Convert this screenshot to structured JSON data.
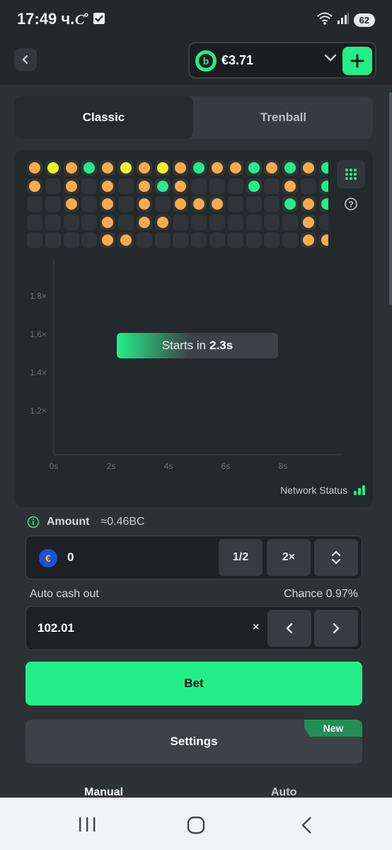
{
  "status_bar": {
    "time": "17:49 ч.",
    "battery": "62",
    "wifi_label": "6"
  },
  "header": {
    "balance": "€3.71",
    "coin_letter": "b"
  },
  "mode_tabs": [
    {
      "label": "Classic",
      "active": true
    },
    {
      "label": "Trenball",
      "active": false
    }
  ],
  "history_colors": {
    "orange": "#fcaa4a",
    "yellow": "#f1f12c",
    "green": "#24ee89"
  },
  "history_rows": [
    [
      "orange",
      "yellow",
      "orange",
      "green",
      "orange",
      "yellow",
      "orange",
      "yellow",
      "orange",
      "green",
      "orange",
      "orange",
      "green",
      "orange",
      "green",
      "orange",
      "green"
    ],
    [
      "orange",
      "",
      "orange",
      "",
      "orange",
      "",
      "orange",
      "green",
      "orange",
      "",
      "",
      "",
      "green",
      "",
      "orange",
      "",
      "green"
    ],
    [
      "",
      "",
      "orange",
      "",
      "orange",
      "",
      "orange",
      "",
      "orange",
      "orange",
      "orange",
      "",
      "",
      "",
      "green",
      "orange",
      "green"
    ],
    [
      "",
      "",
      "",
      "",
      "orange",
      "",
      "orange",
      "orange",
      "",
      "",
      "",
      "",
      "",
      "",
      "",
      "orange",
      ""
    ],
    [
      "",
      "",
      "",
      "",
      "orange",
      "orange",
      "",
      "",
      "",
      "",
      "",
      "",
      "",
      "",
      "",
      "orange",
      "orange"
    ]
  ],
  "chart_data": {
    "type": "line",
    "y_ticks": [
      "1.8×",
      "1.6×",
      "1.4×",
      "1.2×"
    ],
    "x_ticks": [
      "0s",
      "2s",
      "4s",
      "6s",
      "8s"
    ],
    "series": []
  },
  "game": {
    "countdown_prefix": "Starts in",
    "countdown_value": "2.3s",
    "network_status": "Network Status"
  },
  "amount": {
    "label": "Amount",
    "approx": "≈0.46BC",
    "value": "0",
    "currency_symbol": "€",
    "half_label": "1/2",
    "double_label": "2×"
  },
  "auto_cash_out": {
    "label": "Auto cash out",
    "chance": "Chance 0.97%",
    "value": "102.01",
    "unit": "×"
  },
  "bet_label": "Bet",
  "settings": {
    "label": "Settings",
    "badge": "New"
  },
  "bottom_tabs": {
    "manual": "Manual",
    "auto": "Auto"
  }
}
